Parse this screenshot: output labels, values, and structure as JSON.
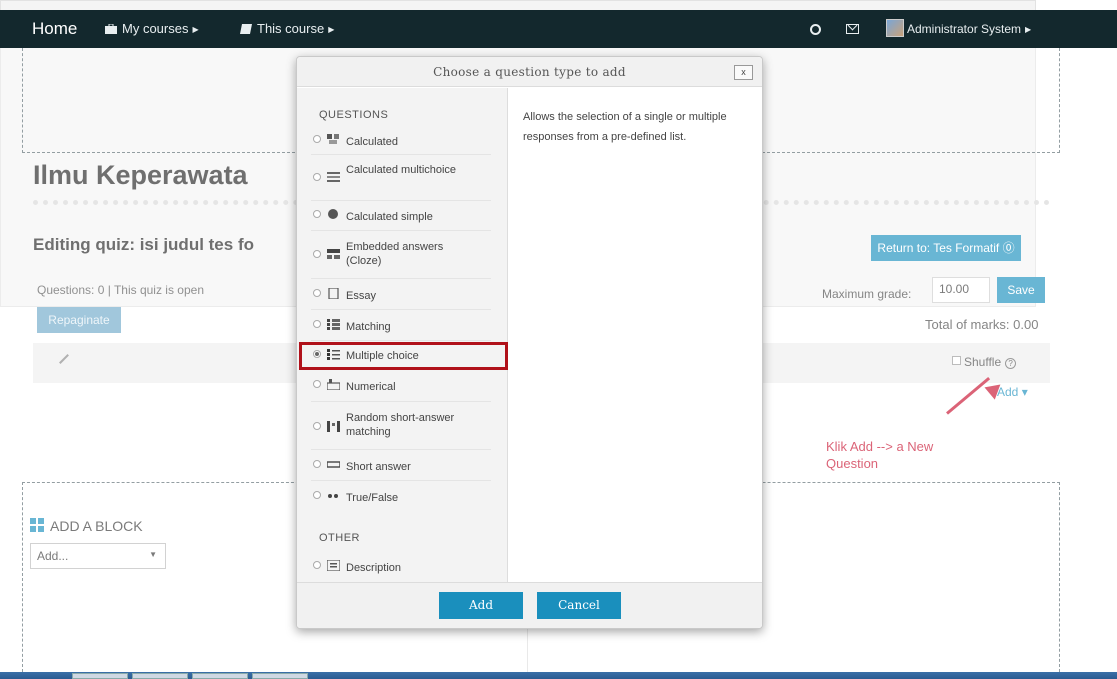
{
  "navbar": {
    "home": "Home",
    "my_courses": "My courses",
    "this_course": "This course",
    "user": "Administrator System"
  },
  "page": {
    "course_title": "Ilmu Keperawata",
    "quiz_heading": "Editing quiz: isi judul tes fo",
    "questions_info": "Questions: 0 | This quiz is open",
    "repaginate": "Repaginate",
    "return_button": "Return to: Tes Formatif",
    "max_grade_label": "Maximum grade:",
    "max_grade_value": "10.00",
    "save": "Save",
    "total_marks": "Total of marks: 0.00",
    "shuffle": "Shuffle",
    "add_link": "Add",
    "annotation": "Klik Add --> a New Question"
  },
  "block": {
    "title": "ADD A BLOCK",
    "select_value": "Add..."
  },
  "modal": {
    "title": "Choose a question type to add",
    "close": "x",
    "section_questions": "QUESTIONS",
    "section_other": "OTHER",
    "questions": [
      {
        "label": "Calculated",
        "icon": "calculated-icon",
        "selected": false
      },
      {
        "label": "Calculated multichoice",
        "icon": "calculated-multichoice-icon",
        "selected": false
      },
      {
        "label": "Calculated simple",
        "icon": "calculated-simple-icon",
        "selected": false
      },
      {
        "label": "Embedded answers (Cloze)",
        "icon": "cloze-icon",
        "selected": false
      },
      {
        "label": "Essay",
        "icon": "essay-icon",
        "selected": false
      },
      {
        "label": "Matching",
        "icon": "matching-icon",
        "selected": false
      },
      {
        "label": "Multiple choice",
        "icon": "multichoice-icon",
        "selected": true
      },
      {
        "label": "Numerical",
        "icon": "numerical-icon",
        "selected": false
      },
      {
        "label": "Random short-answer matching",
        "icon": "random-matching-icon",
        "selected": false
      },
      {
        "label": "Short answer",
        "icon": "short-answer-icon",
        "selected": false
      },
      {
        "label": "True/False",
        "icon": "truefalse-icon",
        "selected": false
      }
    ],
    "other": [
      {
        "label": "Description",
        "icon": "description-icon",
        "selected": false
      }
    ],
    "description": "Allows the selection of a single or multiple responses from a pre-defined list.",
    "add": "Add",
    "cancel": "Cancel"
  },
  "colors": {
    "navbar": "#13282d",
    "accent": "#1a8fbd",
    "annotation": "#c8102e"
  }
}
